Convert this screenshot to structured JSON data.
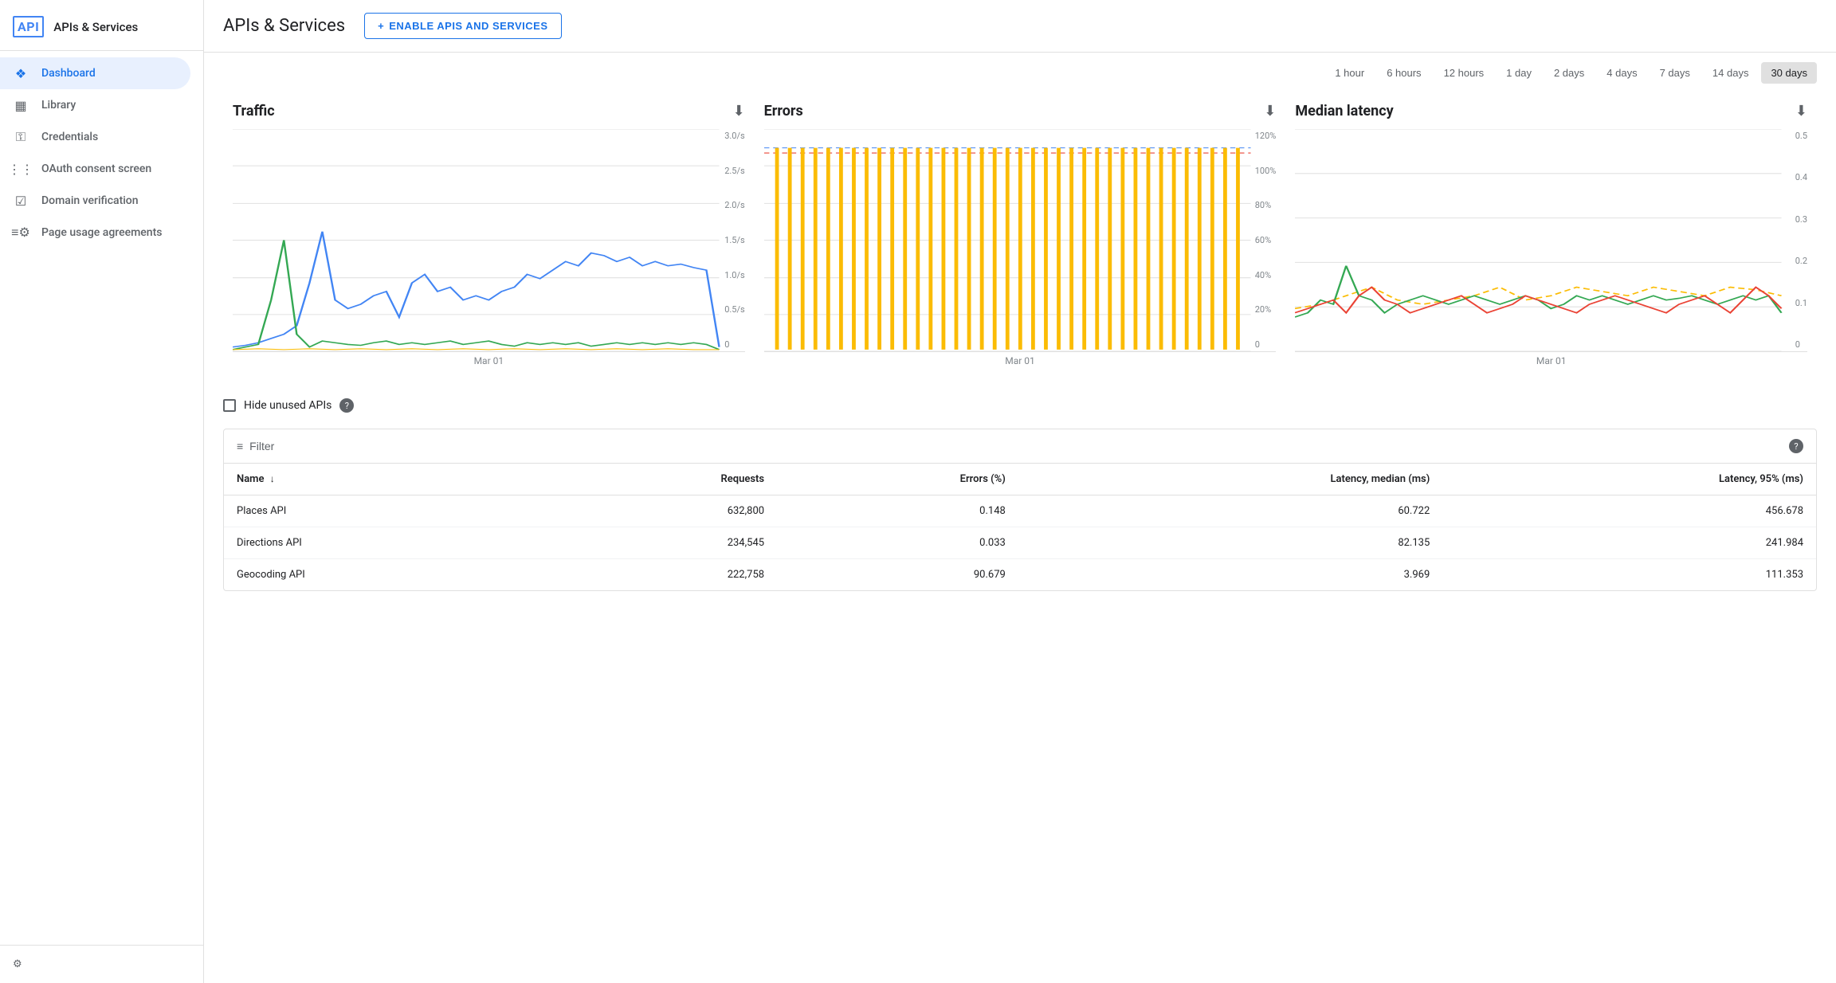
{
  "sidebar": {
    "logo_text": "API",
    "title": "APIs & Services",
    "items": [
      {
        "id": "dashboard",
        "label": "Dashboard",
        "icon": "❖",
        "active": true
      },
      {
        "id": "library",
        "label": "Library",
        "icon": "▦",
        "active": false
      },
      {
        "id": "credentials",
        "label": "Credentials",
        "icon": "⚿",
        "active": false
      },
      {
        "id": "oauth",
        "label": "OAuth consent screen",
        "icon": "⋮⋮",
        "active": false
      },
      {
        "id": "domain",
        "label": "Domain verification",
        "icon": "☑",
        "active": false
      },
      {
        "id": "pageusage",
        "label": "Page usage agreements",
        "icon": "≡⚙",
        "active": false
      }
    ]
  },
  "header": {
    "title": "APIs & Services",
    "enable_btn": "ENABLE APIS AND SERVICES",
    "enable_icon": "+"
  },
  "time_filters": {
    "options": [
      "1 hour",
      "6 hours",
      "12 hours",
      "1 day",
      "2 days",
      "4 days",
      "7 days",
      "14 days",
      "30 days"
    ],
    "active": "30 days"
  },
  "charts": {
    "traffic": {
      "title": "Traffic",
      "x_label": "Mar 01",
      "y_labels": [
        "3.0/s",
        "2.5/s",
        "2.0/s",
        "1.5/s",
        "1.0/s",
        "0.5/s",
        "0"
      ]
    },
    "errors": {
      "title": "Errors",
      "x_label": "Mar 01",
      "y_labels": [
        "120%",
        "100%",
        "80%",
        "60%",
        "40%",
        "20%",
        "0"
      ]
    },
    "latency": {
      "title": "Median latency",
      "x_label": "Mar 01",
      "y_labels": [
        "0.5",
        "0.4",
        "0.3",
        "0.2",
        "0.1",
        "0"
      ]
    }
  },
  "hide_unused": {
    "label": "Hide unused APIs",
    "checked": false
  },
  "table": {
    "filter_label": "Filter",
    "help_icon": "?",
    "columns": [
      "Name",
      "Requests",
      "Errors (%)",
      "Latency, median (ms)",
      "Latency, 95% (ms)"
    ],
    "rows": [
      {
        "name": "Places API",
        "requests": "632,800",
        "errors": "0.148",
        "latency_median": "60.722",
        "latency_95": "456.678"
      },
      {
        "name": "Directions API",
        "requests": "234,545",
        "errors": "0.033",
        "latency_median": "82.135",
        "latency_95": "241.984"
      },
      {
        "name": "Geocoding API",
        "requests": "222,758",
        "errors": "90.679",
        "latency_median": "3.969",
        "latency_95": "111.353"
      }
    ]
  }
}
